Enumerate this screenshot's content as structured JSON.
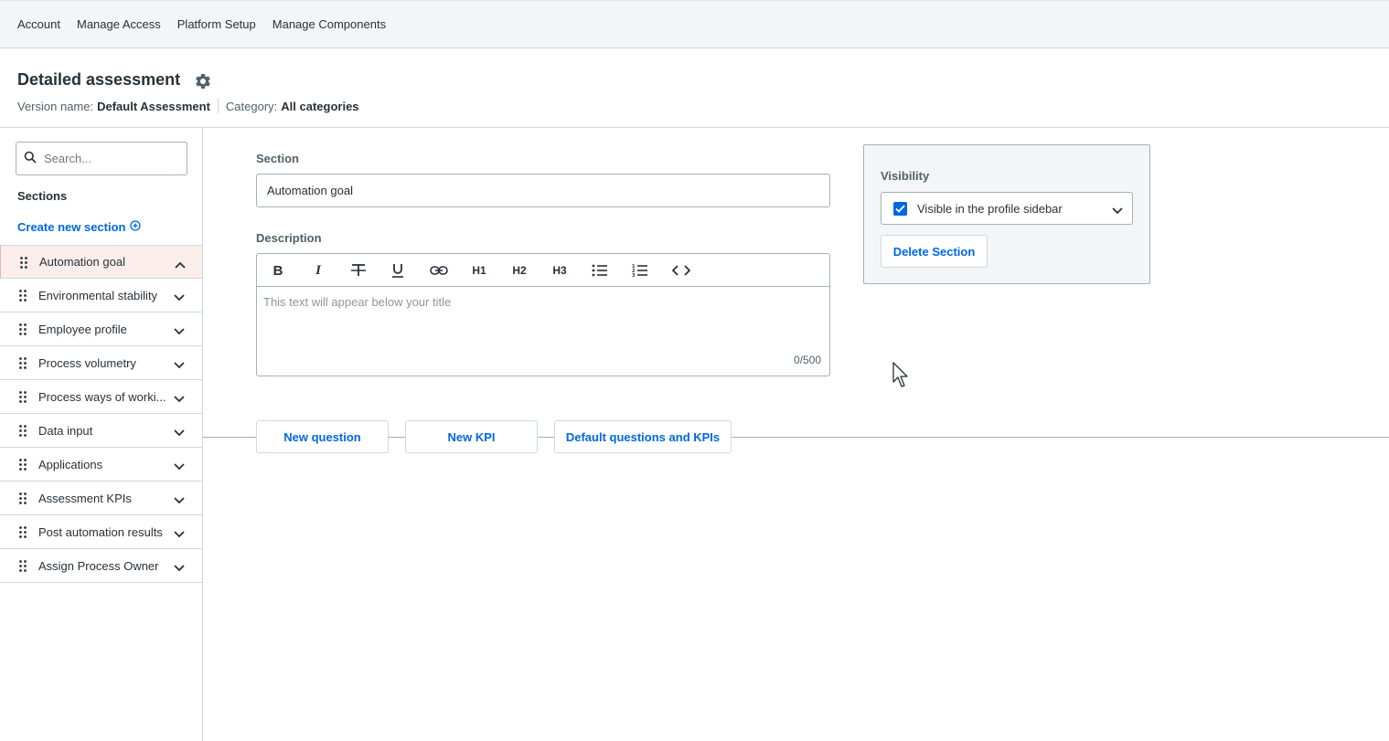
{
  "topnav": {
    "items": [
      {
        "label": "Account"
      },
      {
        "label": "Manage Access"
      },
      {
        "label": "Platform Setup"
      },
      {
        "label": "Manage Components"
      }
    ]
  },
  "header": {
    "title": "Detailed assessment",
    "settings_icon": "gear-icon",
    "version_label": "Version name:",
    "version_value": "Default Assessment",
    "category_label": "Category:",
    "category_value": "All categories"
  },
  "sidebar": {
    "search_placeholder": "Search...",
    "sections_heading": "Sections",
    "create_link": "Create new section",
    "items": [
      {
        "label": "Automation goal",
        "active": true,
        "expanded": true
      },
      {
        "label": "Environmental stability",
        "active": false,
        "expanded": false
      },
      {
        "label": "Employee profile",
        "active": false,
        "expanded": false
      },
      {
        "label": "Process volumetry",
        "active": false,
        "expanded": false
      },
      {
        "label": "Process ways of worki...",
        "active": false,
        "expanded": false
      },
      {
        "label": "Data input",
        "active": false,
        "expanded": false
      },
      {
        "label": "Applications",
        "active": false,
        "expanded": false
      },
      {
        "label": "Assessment KPIs",
        "active": false,
        "expanded": false
      },
      {
        "label": "Post automation results",
        "active": false,
        "expanded": false
      },
      {
        "label": "Assign Process Owner",
        "active": false,
        "expanded": false
      }
    ]
  },
  "form": {
    "section_label": "Section",
    "section_value": "Automation goal",
    "description_label": "Description",
    "toolbar": {
      "bold": "B",
      "italic": "I",
      "h1": "H1",
      "h2": "H2",
      "h3": "H3"
    },
    "description_placeholder": "This text will appear below your title",
    "char_count": "0/500"
  },
  "visibility": {
    "label": "Visibility",
    "option": "Visible in the profile sidebar",
    "checked": true,
    "delete_button": "Delete Section"
  },
  "actions": {
    "new_question": "New question",
    "new_kpi": "New KPI",
    "defaults": "Default questions and KPIs"
  },
  "colors": {
    "accent": "#0067df",
    "active_row": "#fbeeea",
    "text": "#273139",
    "border": "#a4b1b8"
  }
}
